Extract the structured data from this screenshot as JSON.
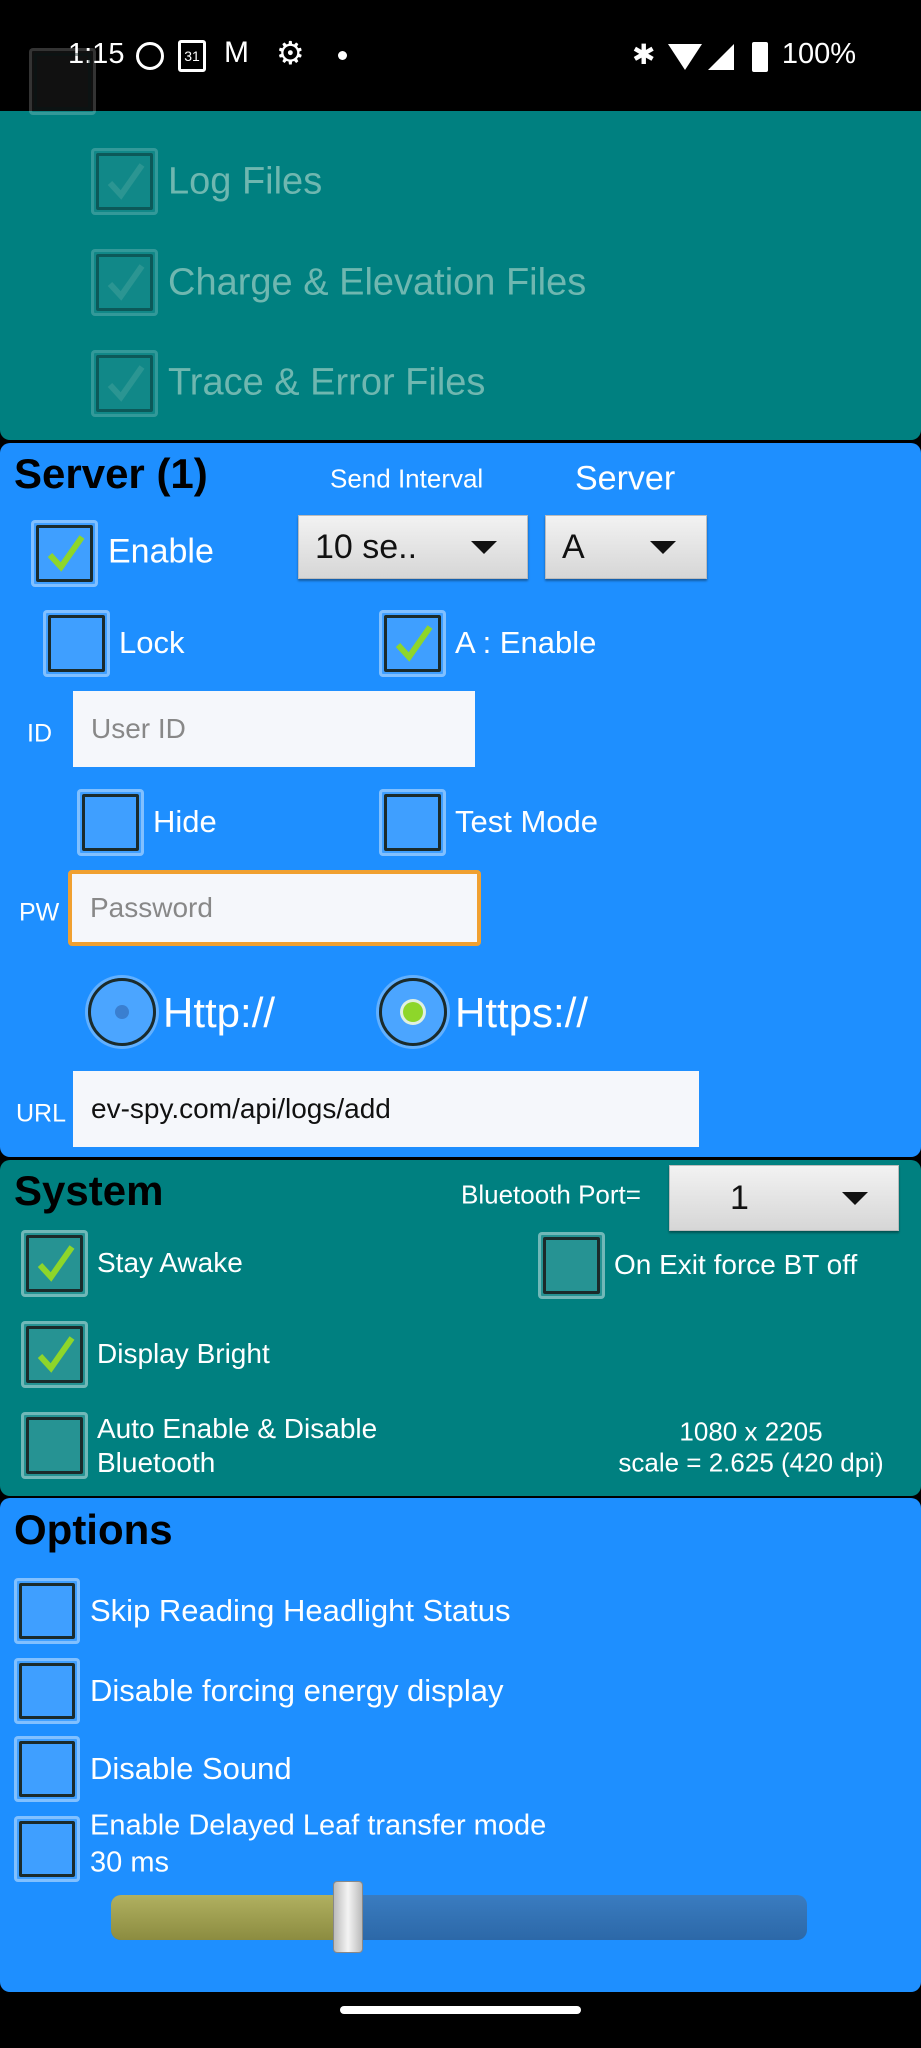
{
  "status_bar": {
    "time": "1:15",
    "battery": "100%",
    "icons": [
      "face-icon",
      "calendar-icon",
      "gmail-icon",
      "settings-icon",
      "dot-icon",
      "bluetooth-icon",
      "wifi-icon",
      "signal-icon",
      "battery-charging-icon"
    ],
    "calendar_day": "31"
  },
  "files": {
    "items": [
      {
        "label": "Log Files",
        "checked": true
      },
      {
        "label": "Charge & Elevation Files",
        "checked": true
      },
      {
        "label": "Trace & Error Files",
        "checked": true
      }
    ]
  },
  "server": {
    "title": "Server (1)",
    "send_interval_label": "Send Interval",
    "send_interval_value": "10 se..",
    "server_label": "Server",
    "server_value": "A",
    "enable": {
      "label": "Enable",
      "checked": true
    },
    "lock": {
      "label": "Lock",
      "checked": false
    },
    "a_enable": {
      "label": "A : Enable",
      "checked": true
    },
    "id_label": "ID",
    "id_placeholder": "User ID",
    "hide": {
      "label": "Hide",
      "checked": false
    },
    "test_mode": {
      "label": "Test Mode",
      "checked": false
    },
    "pw_label": "PW",
    "pw_placeholder": "Password",
    "http": {
      "label": "Http://",
      "selected": false
    },
    "https": {
      "label": "Https://",
      "selected": true
    },
    "url_label": "URL",
    "url_value": "ev-spy.com/api/logs/add"
  },
  "system": {
    "title": "System",
    "bt_port_label": "Bluetooth Port=",
    "bt_port_value": "1",
    "stay_awake": {
      "label": "Stay Awake",
      "checked": true
    },
    "exit_bt_off": {
      "label": "On Exit force BT off",
      "checked": false
    },
    "display_bright": {
      "label": "Display Bright",
      "checked": true
    },
    "auto_bt": {
      "label1": "Auto Enable & Disable",
      "label2": "Bluetooth",
      "checked": false
    },
    "resolution": "1080 x 2205",
    "scale": "scale = 2.625 (420 dpi)"
  },
  "options": {
    "title": "Options",
    "skip_headlight": {
      "label": "Skip Reading Headlight Status",
      "checked": false
    },
    "disable_energy": {
      "label": "Disable forcing energy display",
      "checked": false
    },
    "disable_sound": {
      "label": "Disable Sound",
      "checked": false
    },
    "delayed_leaf": {
      "label": "Enable Delayed Leaf transfer mode",
      "value": "30 ms",
      "checked": false
    },
    "slider_fraction": 0.34
  },
  "colors": {
    "teal": "#008080",
    "blue": "#1E8FFF",
    "check": "#8ED62A",
    "focus": "#F0A030"
  }
}
